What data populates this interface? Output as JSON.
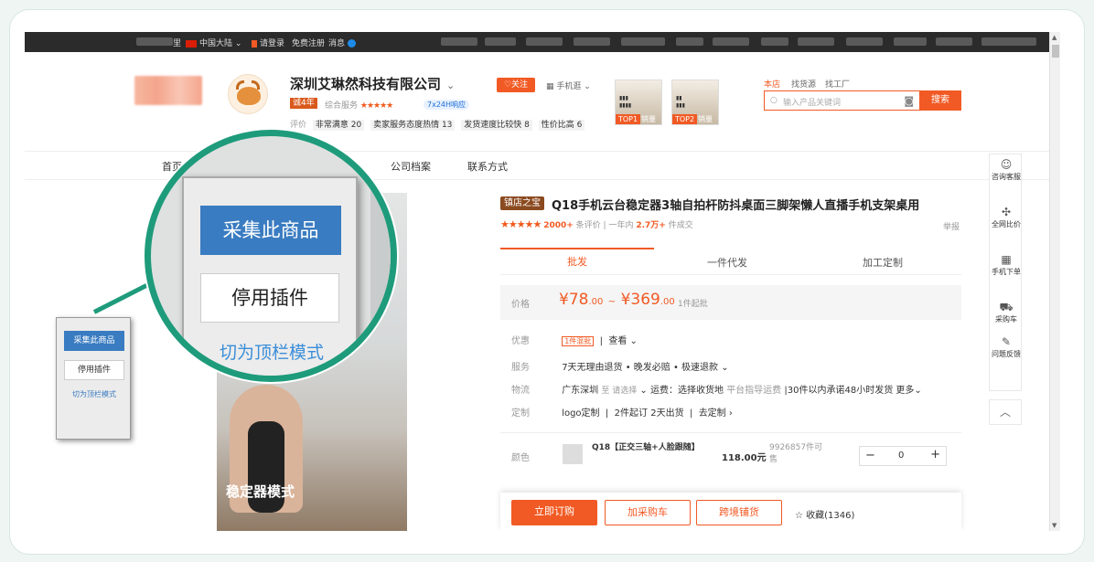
{
  "topbar": {
    "region_suffix": "里",
    "region": "中国大陆",
    "login": "请登录",
    "register": "免费注册",
    "messages": "消息"
  },
  "shop": {
    "name": "深圳艾琳然科技有限公司",
    "years": "诚4年",
    "score_label": "综合服务",
    "service_badge": "7x24H响应",
    "rating_prefix": "评价",
    "ratings": [
      "非常满意 20",
      "卖家服务态度热情 13",
      "发货速度比较快 8",
      "性价比高 6"
    ],
    "follow": "关注",
    "mobile": "手机逛",
    "promo1": {
      "tag": "TOP1",
      "text": "销量"
    },
    "promo2": {
      "tag": "TOP2",
      "text": "销量"
    },
    "search_tabs": [
      "本店",
      "找货源",
      "找工厂"
    ],
    "search_placeholder": "输入产品关键词",
    "search_button": "搜索"
  },
  "nav": [
    "首页",
    "公司档案",
    "联系方式"
  ],
  "product": {
    "image_caption": "稳定器模式",
    "shop_tag": "镇店之宝",
    "title": "Q18手机云台稳定器3轴自拍杆防抖桌面三脚架懒人直播手机支架桌用",
    "reviews": "2000+",
    "reviews_label": "条评价",
    "sales_label": "一年内",
    "sales": "2.7万+",
    "sales_unit": "件成交",
    "report": "举报",
    "tabs": [
      "批发",
      "一件代发",
      "加工定制"
    ],
    "price_label": "价格",
    "price_low": "78",
    "price_low_dec": ".00",
    "price_high": "369",
    "price_high_dec": ".00",
    "min_order": "1件起批",
    "rows": {
      "discount_label": "优惠",
      "discount_tag": "1件混批",
      "discount_link": "查看",
      "service_label": "服务",
      "service": "7天无理由退货 • 晚发必赔 • 极速退款",
      "logistics_label": "物流",
      "logistics_from": "广东深圳",
      "logistics_to": "至 请选择",
      "logistics_fee": "运费：选择收货地",
      "logistics_note": "平台指导运费",
      "logistics_ship": "30件以内承诺48小时发货",
      "logistics_more": "更多",
      "custom_label": "定制",
      "custom_items": [
        "logo定制",
        "2件起订",
        "2天出货"
      ],
      "custom_link": "去定制"
    },
    "sku": {
      "label": "颜色",
      "name": "Q18【正交三轴+人脸跟随】",
      "price": "118.00元",
      "stock": "9926857件可售",
      "qty": "0"
    },
    "actions": {
      "buy": "立即订购",
      "cart": "加采购车",
      "cross": "跨境铺货",
      "favorite": "收藏(1346)"
    }
  },
  "sidebar": [
    {
      "icon": "chat-icon",
      "label": "咨询客服"
    },
    {
      "icon": "compare-icon",
      "label": "全网比价"
    },
    {
      "icon": "qrcode-icon",
      "label": "手机下单"
    },
    {
      "icon": "cart-icon",
      "label": "采购车"
    },
    {
      "icon": "edit-icon",
      "label": "问题反馈"
    }
  ],
  "plugin": {
    "collect": "采集此商品",
    "disable": "停用插件",
    "switch": "切为顶栏模式"
  },
  "colors": {
    "accent": "#f15a24",
    "plugin_blue": "#3a7cc1",
    "highlight": "#1e9b7b"
  }
}
